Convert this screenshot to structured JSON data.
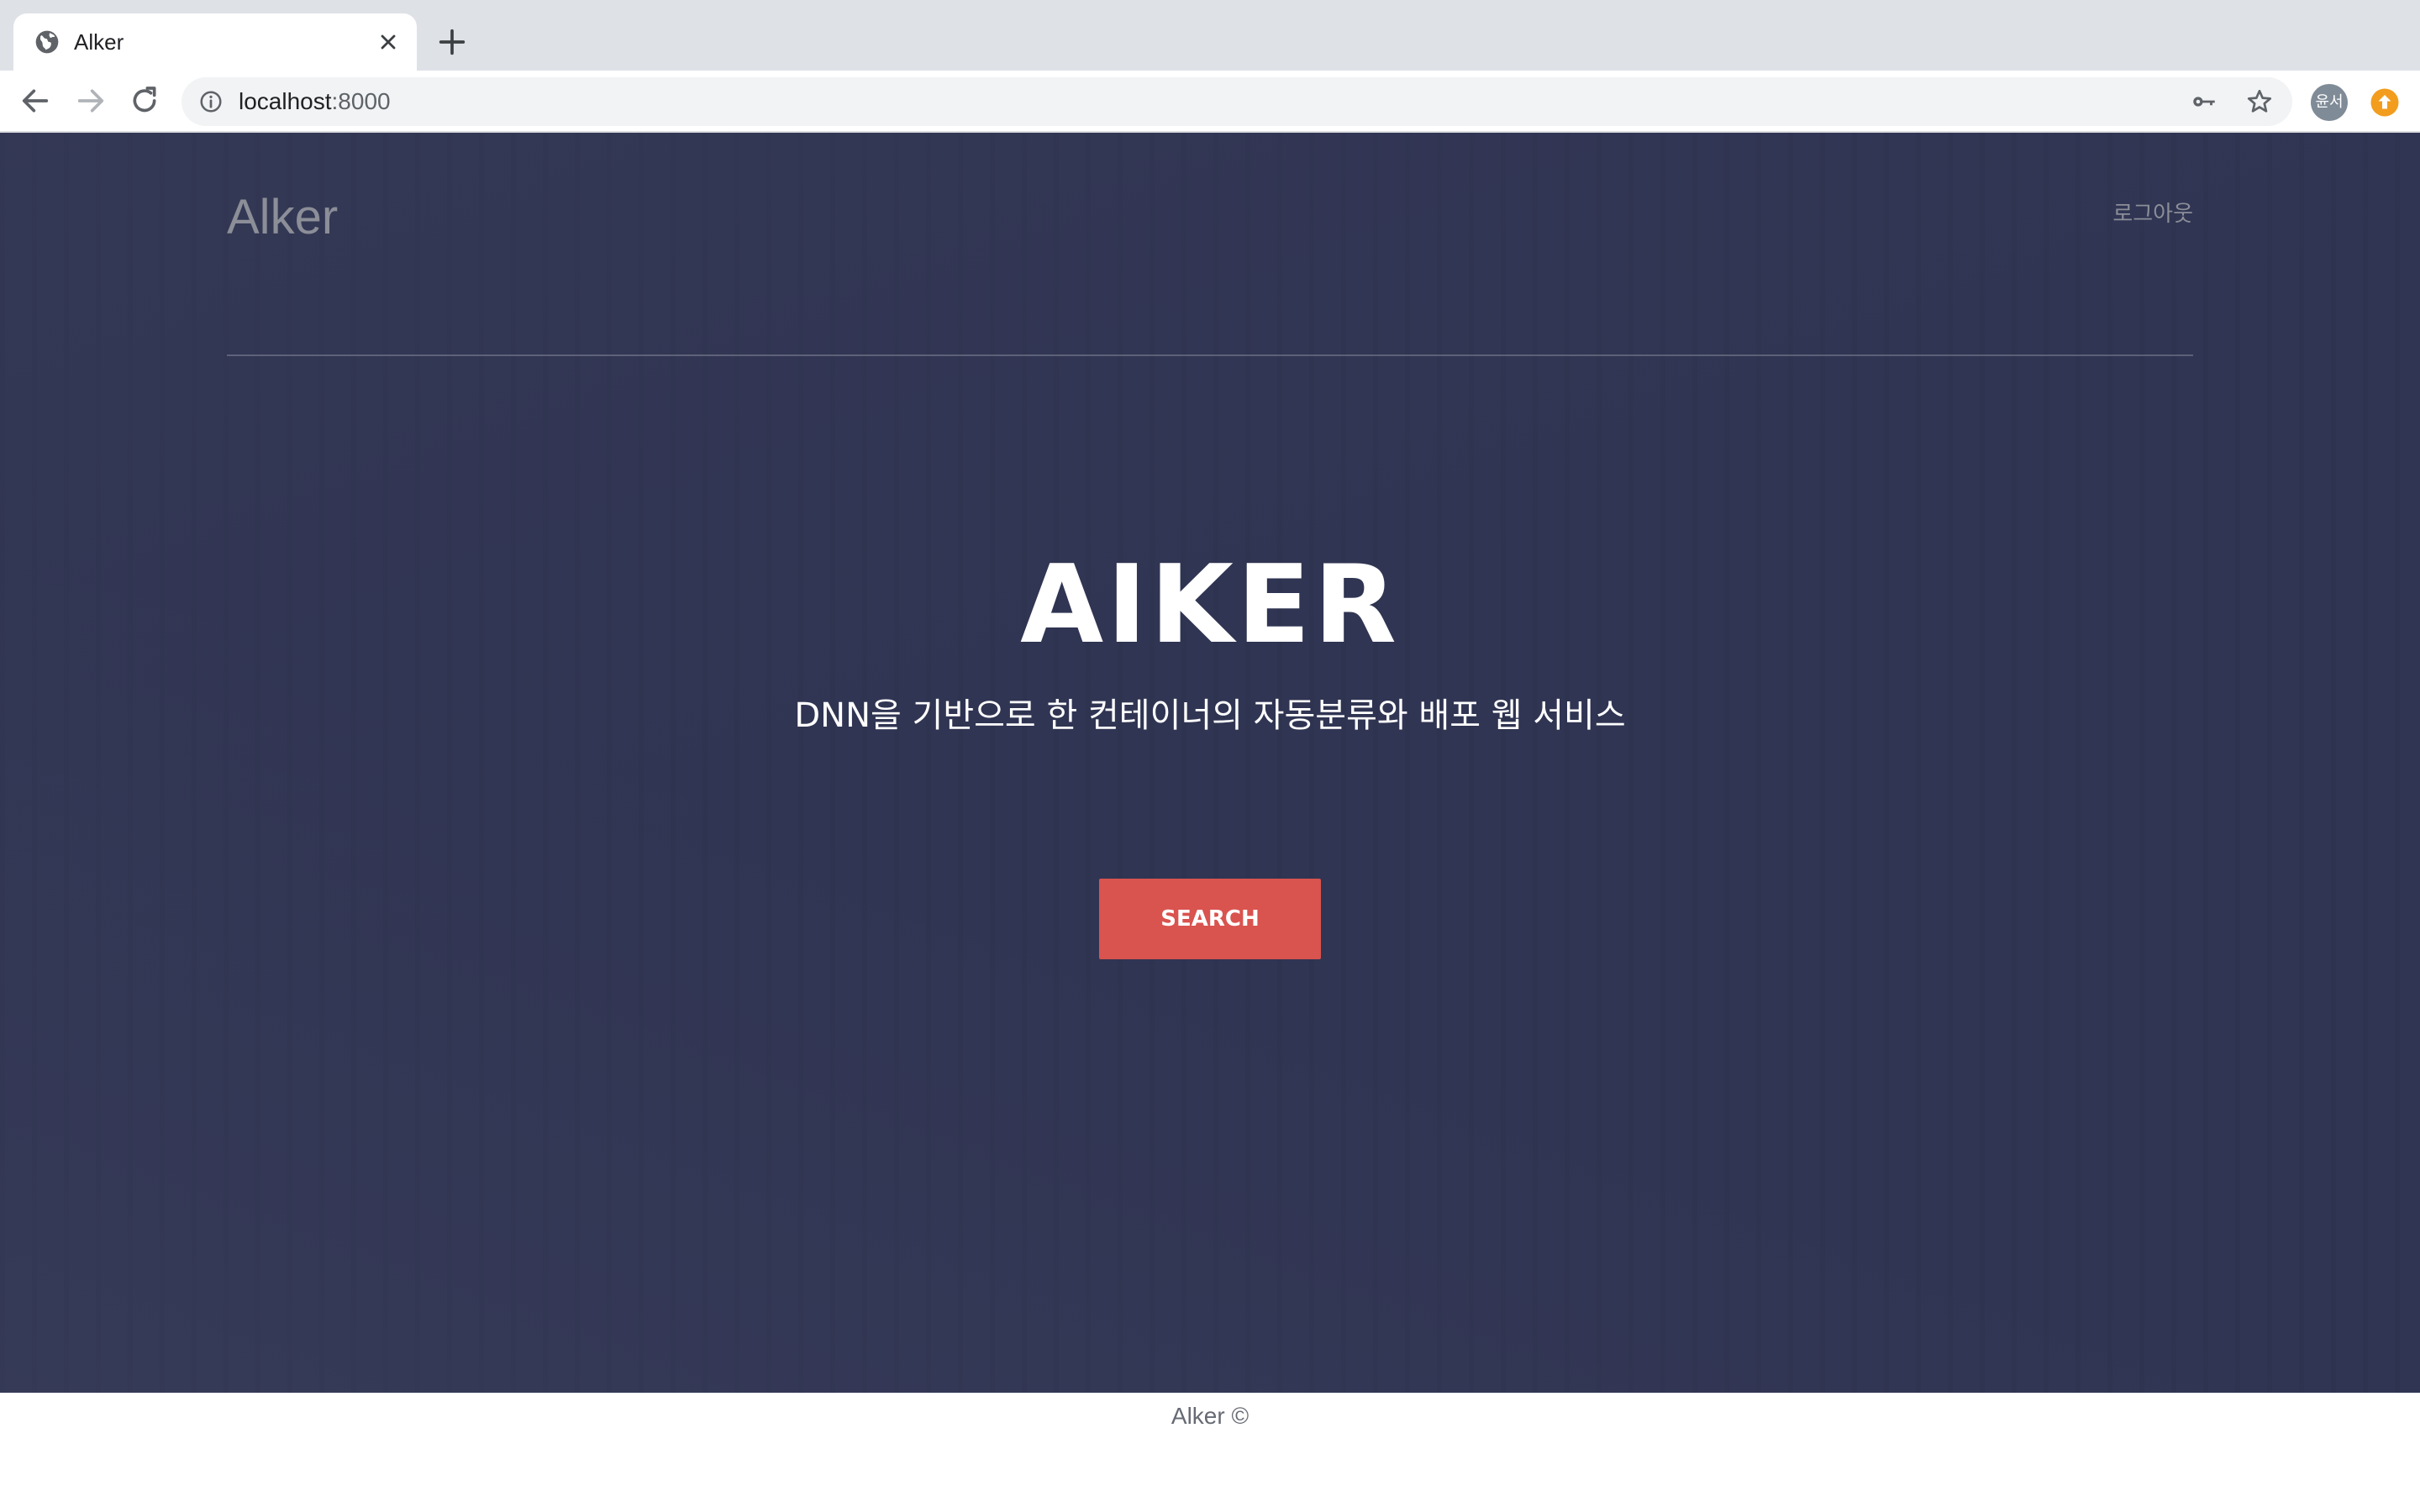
{
  "browser": {
    "tab": {
      "title": "Alker",
      "favicon": "globe-icon"
    },
    "address": {
      "host": "localhost",
      "port": ":8000"
    },
    "profile": {
      "initials": "윤서"
    },
    "icons": {
      "back": "arrow-left-icon",
      "forward": "arrow-right-icon",
      "reload": "reload-icon",
      "info": "info-icon",
      "key": "key-icon",
      "bookmark": "star-icon",
      "extension": "extension-icon",
      "close_tab": "close-icon",
      "new_tab": "plus-icon"
    }
  },
  "page": {
    "brand": "Alker",
    "nav": {
      "logout": "로그아웃"
    },
    "hero": {
      "title": "AIKER",
      "subtitle": "DNN을 기반으로 한 컨테이너의 자동분류와 배포 웹 서비스",
      "button_label": "SEARCH"
    },
    "footer": {
      "text": "Alker ©"
    },
    "colors": {
      "hero_background": "#303553",
      "button": "#d9534f",
      "muted_text": "#8c8e98"
    }
  }
}
